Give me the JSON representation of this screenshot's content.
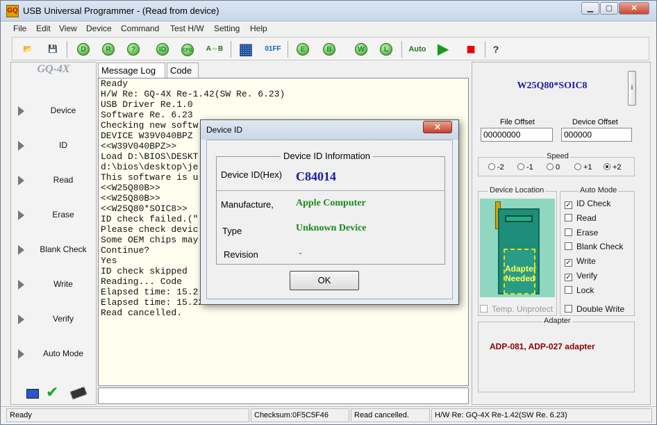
{
  "window": {
    "title": "USB Universal Programmer - (Read from device)",
    "app_icon_text": "GQ"
  },
  "menu": [
    "File",
    "Edit",
    "View",
    "Device",
    "Command",
    "Test H/W",
    "Setting",
    "Help"
  ],
  "toolbar": {
    "buttons": [
      {
        "name": "open-icon",
        "glyph": "📂"
      },
      {
        "name": "save-icon",
        "glyph": "💾"
      },
      {
        "name": "detect-device-icon",
        "glyph": "D"
      },
      {
        "name": "read-icon",
        "glyph": "R"
      },
      {
        "name": "blank-check-icon",
        "glyph": "?"
      },
      {
        "name": "read-id-icon",
        "glyph": "ID"
      },
      {
        "name": "config-icon",
        "glyph": "CFG"
      },
      {
        "name": "compare-icon",
        "glyph": "A⇔B"
      },
      {
        "name": "calculator-icon",
        "glyph": "▦"
      },
      {
        "name": "checksum-icon",
        "glyph": "01FF"
      },
      {
        "name": "erase-icon",
        "glyph": "E"
      },
      {
        "name": "blank-icon",
        "glyph": "B"
      },
      {
        "name": "write-icon",
        "glyph": "W"
      },
      {
        "name": "lock-icon",
        "glyph": "L"
      },
      {
        "name": "auto-icon",
        "glyph": "Auto"
      },
      {
        "name": "run-icon",
        "glyph": "▶"
      },
      {
        "name": "stop-icon",
        "glyph": "■"
      },
      {
        "name": "help-icon",
        "glyph": "?"
      }
    ]
  },
  "left": {
    "logo": "GQ-4X",
    "nav": [
      "Device",
      "ID",
      "Read",
      "Erase",
      "Blank Check",
      "Write",
      "Verify",
      "Auto Mode"
    ]
  },
  "tabs": [
    "Message Log",
    "Code"
  ],
  "log": [
    "Ready",
    "H/W Re: GQ-4X Re-1.42(SW Re. 6.23)",
    "USB Driver Re.1.0",
    "Software Re. 6.23",
    "Checking new softw",
    "DEVICE W39V040BPZ",
    "<<W39V040BPZ>>",
    "Load D:\\BIOS\\DESKT",
    "d:\\bios\\desktop\\je",
    "This software is u",
    "<<W25Q80B>>",
    "<<W25Q80B>>",
    "<<W25Q80*SOIC8>>",
    "ID check failed.(\"",
    "Please check devic",
    "Some OEM chips may",
    "Continue?",
    "Yes",
    "ID check skipped",
    "Reading... Code",
    "Elapsed time: 15.2",
    "Elapsed time: 15.22 seconds.",
    "Read cancelled."
  ],
  "right": {
    "chip": "W25Q80*SOIC8",
    "info_button": "i",
    "file_offset_label": "File Offset",
    "file_offset": "00000000",
    "device_offset_label": "Device Offset",
    "device_offset": "000000",
    "speed_label": "Speed",
    "speeds": [
      "-2",
      "-1",
      "0",
      "+1",
      "+2"
    ],
    "speed_selected": "+2",
    "device_location_label": "Device Location",
    "adapter_needed": "Adapter Needed",
    "temp_unprotect": "Temp. Unprotect",
    "auto_mode_label": "Auto Mode",
    "auto_mode": [
      {
        "label": "ID Check",
        "checked": true
      },
      {
        "label": "Read",
        "checked": false
      },
      {
        "label": "Erase",
        "checked": false
      },
      {
        "label": "Blank Check",
        "checked": false
      },
      {
        "label": "Write",
        "checked": true
      },
      {
        "label": "Verify",
        "checked": true
      },
      {
        "label": "Lock",
        "checked": false
      }
    ],
    "double_write": "Double Write",
    "adapter_label": "Adapter",
    "adapter_text": "ADP-081, ADP-027 adapter"
  },
  "status": {
    "ready": "Ready",
    "checksum": "Checksum:0F5C5F46",
    "message": "Read cancelled.",
    "hw": "H/W Re: GQ-4X Re-1.42(SW Re. 6.23)"
  },
  "dialog": {
    "title": "Device ID",
    "group_title": "Device ID Information",
    "id_label": "Device ID(Hex)",
    "id_value": "C84014",
    "manufacture_label": "Manufacture,",
    "manufacture_value": "Apple Computer",
    "type_label": "Type",
    "type_value": "Unknown Device",
    "revision_label": "Revision",
    "revision_value": "-",
    "ok": "OK"
  },
  "colors": {
    "id_value": "#1a1aa8",
    "value_green": "#1a8a1a",
    "adapter_red": "#8a0000"
  }
}
